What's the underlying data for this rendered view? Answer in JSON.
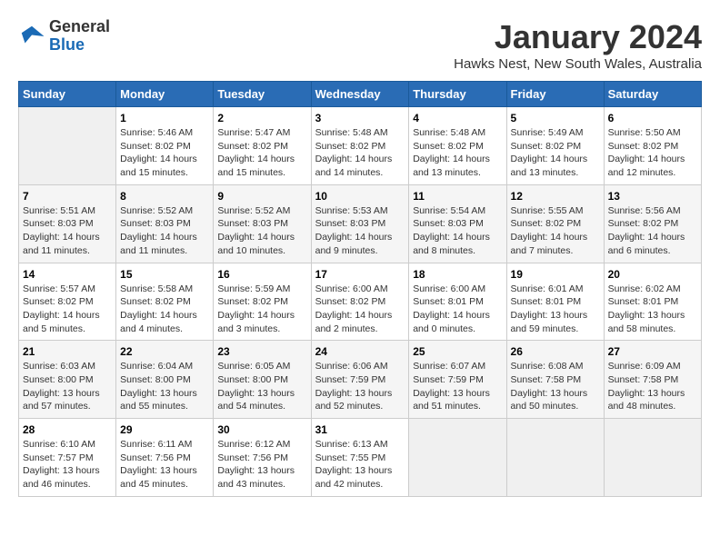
{
  "header": {
    "logo_line1": "General",
    "logo_line2": "Blue",
    "month": "January 2024",
    "location": "Hawks Nest, New South Wales, Australia"
  },
  "days_of_week": [
    "Sunday",
    "Monday",
    "Tuesday",
    "Wednesday",
    "Thursday",
    "Friday",
    "Saturday"
  ],
  "weeks": [
    [
      {
        "num": "",
        "info": ""
      },
      {
        "num": "1",
        "info": "Sunrise: 5:46 AM\nSunset: 8:02 PM\nDaylight: 14 hours\nand 15 minutes."
      },
      {
        "num": "2",
        "info": "Sunrise: 5:47 AM\nSunset: 8:02 PM\nDaylight: 14 hours\nand 15 minutes."
      },
      {
        "num": "3",
        "info": "Sunrise: 5:48 AM\nSunset: 8:02 PM\nDaylight: 14 hours\nand 14 minutes."
      },
      {
        "num": "4",
        "info": "Sunrise: 5:48 AM\nSunset: 8:02 PM\nDaylight: 14 hours\nand 13 minutes."
      },
      {
        "num": "5",
        "info": "Sunrise: 5:49 AM\nSunset: 8:02 PM\nDaylight: 14 hours\nand 13 minutes."
      },
      {
        "num": "6",
        "info": "Sunrise: 5:50 AM\nSunset: 8:02 PM\nDaylight: 14 hours\nand 12 minutes."
      }
    ],
    [
      {
        "num": "7",
        "info": "Sunrise: 5:51 AM\nSunset: 8:03 PM\nDaylight: 14 hours\nand 11 minutes."
      },
      {
        "num": "8",
        "info": "Sunrise: 5:52 AM\nSunset: 8:03 PM\nDaylight: 14 hours\nand 11 minutes."
      },
      {
        "num": "9",
        "info": "Sunrise: 5:52 AM\nSunset: 8:03 PM\nDaylight: 14 hours\nand 10 minutes."
      },
      {
        "num": "10",
        "info": "Sunrise: 5:53 AM\nSunset: 8:03 PM\nDaylight: 14 hours\nand 9 minutes."
      },
      {
        "num": "11",
        "info": "Sunrise: 5:54 AM\nSunset: 8:03 PM\nDaylight: 14 hours\nand 8 minutes."
      },
      {
        "num": "12",
        "info": "Sunrise: 5:55 AM\nSunset: 8:02 PM\nDaylight: 14 hours\nand 7 minutes."
      },
      {
        "num": "13",
        "info": "Sunrise: 5:56 AM\nSunset: 8:02 PM\nDaylight: 14 hours\nand 6 minutes."
      }
    ],
    [
      {
        "num": "14",
        "info": "Sunrise: 5:57 AM\nSunset: 8:02 PM\nDaylight: 14 hours\nand 5 minutes."
      },
      {
        "num": "15",
        "info": "Sunrise: 5:58 AM\nSunset: 8:02 PM\nDaylight: 14 hours\nand 4 minutes."
      },
      {
        "num": "16",
        "info": "Sunrise: 5:59 AM\nSunset: 8:02 PM\nDaylight: 14 hours\nand 3 minutes."
      },
      {
        "num": "17",
        "info": "Sunrise: 6:00 AM\nSunset: 8:02 PM\nDaylight: 14 hours\nand 2 minutes."
      },
      {
        "num": "18",
        "info": "Sunrise: 6:00 AM\nSunset: 8:01 PM\nDaylight: 14 hours\nand 0 minutes."
      },
      {
        "num": "19",
        "info": "Sunrise: 6:01 AM\nSunset: 8:01 PM\nDaylight: 13 hours\nand 59 minutes."
      },
      {
        "num": "20",
        "info": "Sunrise: 6:02 AM\nSunset: 8:01 PM\nDaylight: 13 hours\nand 58 minutes."
      }
    ],
    [
      {
        "num": "21",
        "info": "Sunrise: 6:03 AM\nSunset: 8:00 PM\nDaylight: 13 hours\nand 57 minutes."
      },
      {
        "num": "22",
        "info": "Sunrise: 6:04 AM\nSunset: 8:00 PM\nDaylight: 13 hours\nand 55 minutes."
      },
      {
        "num": "23",
        "info": "Sunrise: 6:05 AM\nSunset: 8:00 PM\nDaylight: 13 hours\nand 54 minutes."
      },
      {
        "num": "24",
        "info": "Sunrise: 6:06 AM\nSunset: 7:59 PM\nDaylight: 13 hours\nand 52 minutes."
      },
      {
        "num": "25",
        "info": "Sunrise: 6:07 AM\nSunset: 7:59 PM\nDaylight: 13 hours\nand 51 minutes."
      },
      {
        "num": "26",
        "info": "Sunrise: 6:08 AM\nSunset: 7:58 PM\nDaylight: 13 hours\nand 50 minutes."
      },
      {
        "num": "27",
        "info": "Sunrise: 6:09 AM\nSunset: 7:58 PM\nDaylight: 13 hours\nand 48 minutes."
      }
    ],
    [
      {
        "num": "28",
        "info": "Sunrise: 6:10 AM\nSunset: 7:57 PM\nDaylight: 13 hours\nand 46 minutes."
      },
      {
        "num": "29",
        "info": "Sunrise: 6:11 AM\nSunset: 7:56 PM\nDaylight: 13 hours\nand 45 minutes."
      },
      {
        "num": "30",
        "info": "Sunrise: 6:12 AM\nSunset: 7:56 PM\nDaylight: 13 hours\nand 43 minutes."
      },
      {
        "num": "31",
        "info": "Sunrise: 6:13 AM\nSunset: 7:55 PM\nDaylight: 13 hours\nand 42 minutes."
      },
      {
        "num": "",
        "info": ""
      },
      {
        "num": "",
        "info": ""
      },
      {
        "num": "",
        "info": ""
      }
    ]
  ]
}
